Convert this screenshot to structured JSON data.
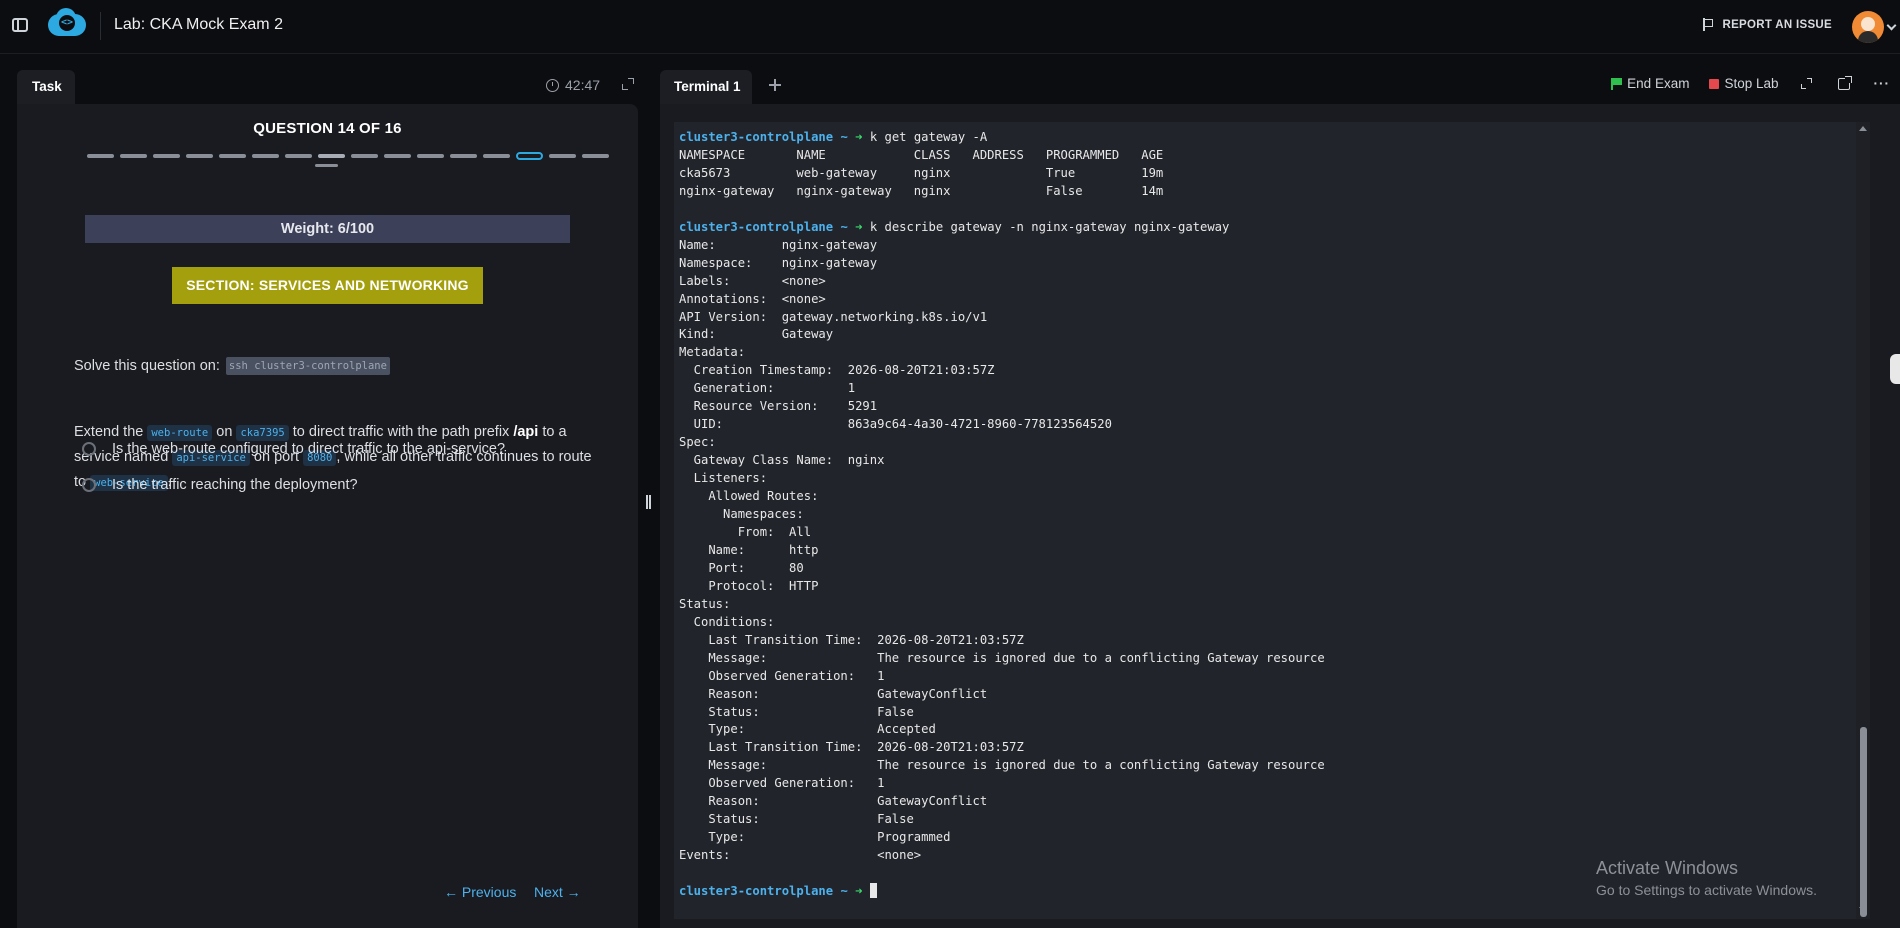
{
  "header": {
    "lab_title": "Lab: CKA Mock Exam 2",
    "report_label": "REPORT AN ISSUE"
  },
  "task_panel": {
    "tab_label": "Task",
    "timer": "42:47",
    "question_title": "QUESTION 14 OF 16",
    "question_total": 16,
    "question_current": 14,
    "weight": "Weight: 6/100",
    "section": "SECTION: SERVICES AND NETWORKING",
    "solve_prefix": "Solve this question on:",
    "solve_host": "ssh cluster3-controlplane",
    "desc": {
      "p1": "Extend the",
      "route": "web-route",
      "p2": "on",
      "ns": "cka7395",
      "p3": "to direct traffic with the path prefix",
      "prefix": "/api",
      "p4": "to a service named",
      "service": "api-service",
      "p5": "on port",
      "port": "8080",
      "p6": ", while all other traffic continues to route to",
      "default_service": "web-service",
      "p7": "."
    },
    "checks": [
      "Is the web-route configured to direct traffic to the api-service?",
      "Is the traffic reaching the deployment?"
    ],
    "prev_label": "← Previous",
    "next_label": "Next →"
  },
  "terminal": {
    "tab_label": "Terminal 1",
    "end_exam_label": "End Exam",
    "stop_lab_label": "Stop Lab",
    "prompt": "cluster3-controlplane",
    "prompt_symbol": "~ ➜",
    "commands": [
      "k get gateway -A",
      "k describe gateway -n nginx-gateway nginx-gateway"
    ],
    "get_output": [
      "NAMESPACE       NAME            CLASS   ADDRESS   PROGRAMMED   AGE",
      "cka5673         web-gateway     nginx             True         19m",
      "nginx-gateway   nginx-gateway   nginx             False        14m"
    ],
    "describe_output": [
      "Name:         nginx-gateway",
      "Namespace:    nginx-gateway",
      "Labels:       <none>",
      "Annotations:  <none>",
      "API Version:  gateway.networking.k8s.io/v1",
      "Kind:         Gateway",
      "Metadata:",
      "  Creation Timestamp:  2026-08-20T21:03:57Z",
      "  Generation:          1",
      "  Resource Version:    5291",
      "  UID:                 863a9c64-4a30-4721-8960-778123564520",
      "Spec:",
      "  Gateway Class Name:  nginx",
      "  Listeners:",
      "    Allowed Routes:",
      "      Namespaces:",
      "        From:  All",
      "    Name:      http",
      "    Port:      80",
      "    Protocol:  HTTP",
      "Status:",
      "  Conditions:",
      "    Last Transition Time:  2026-08-20T21:03:57Z",
      "    Message:               The resource is ignored due to a conflicting Gateway resource",
      "    Observed Generation:   1",
      "    Reason:                GatewayConflict",
      "    Status:                False",
      "    Type:                  Accepted",
      "    Last Transition Time:  2026-08-20T21:03:57Z",
      "    Message:               The resource is ignored due to a conflicting Gateway resource",
      "    Observed Generation:   1",
      "    Reason:                GatewayConflict",
      "    Status:                False",
      "    Type:                  Programmed",
      "Events:                    <none>"
    ]
  },
  "watermark": {
    "line1": "Activate Windows",
    "line2": "Go to Settings to activate Windows."
  },
  "colors": {
    "accent": "#2da9e1",
    "section_bg": "#a39f0d",
    "weight_bg": "#3c4058",
    "prompt": "#4cb1ec",
    "arrow": "#38d96a",
    "end_flag": "#2fbf4f",
    "stop": "#e5484d"
  }
}
